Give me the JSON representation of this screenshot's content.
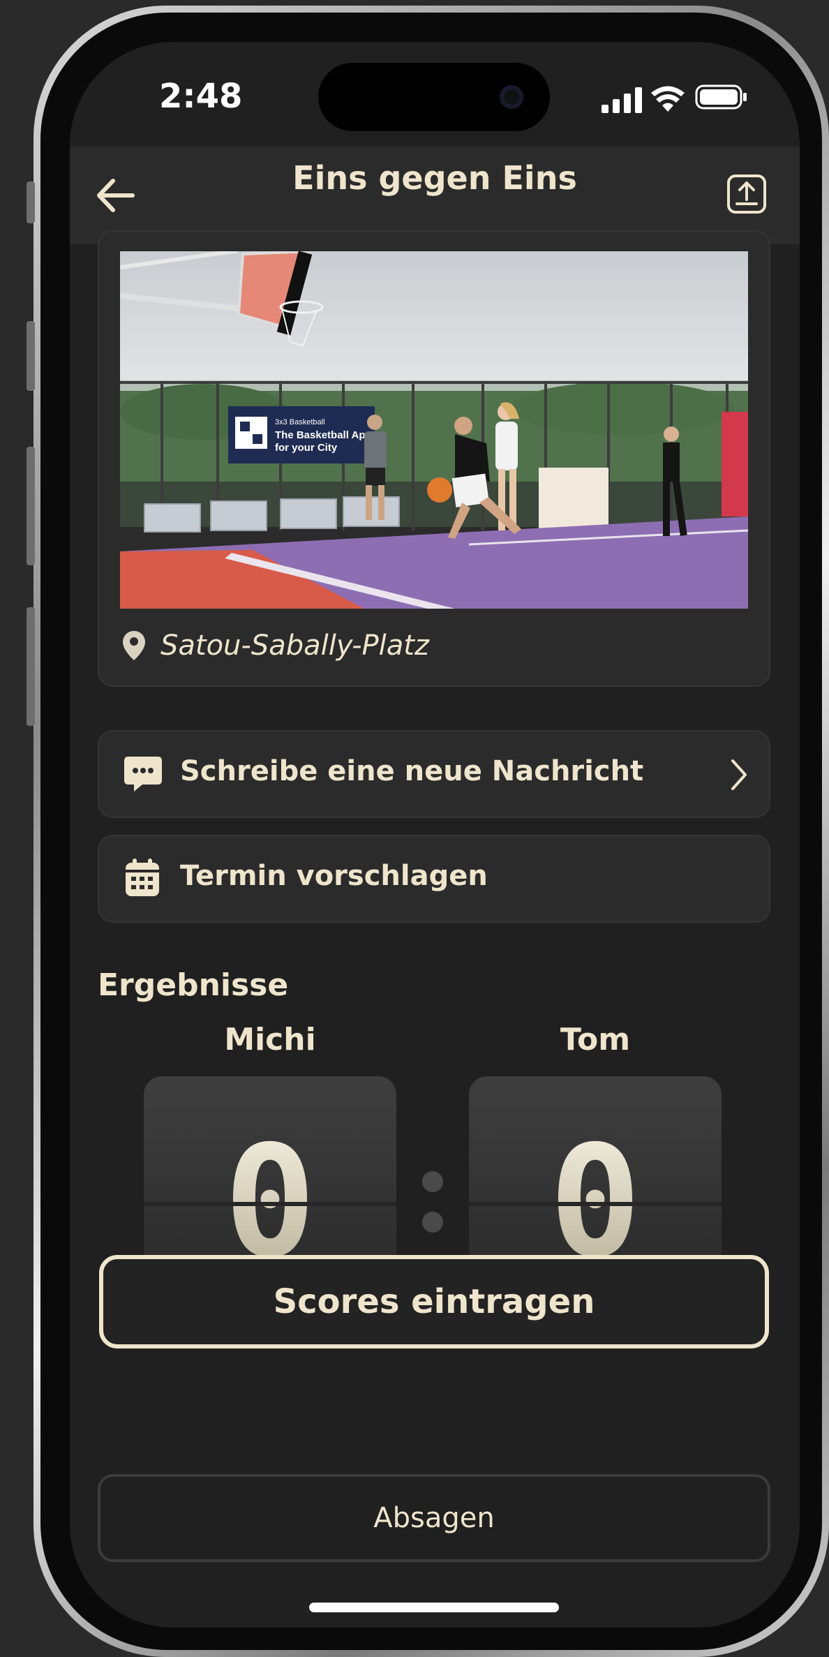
{
  "status_bar": {
    "time": "2:48"
  },
  "header": {
    "title": "Eins gegen Eins"
  },
  "location_card": {
    "photo_alt": "Basketball players on an outdoor court",
    "location_name": "Satou-Sabally-Platz",
    "banner_line1": "The Basketball App",
    "banner_line2": "for your City",
    "banner_brand": "3x3 Basketball"
  },
  "actions": {
    "message_label": "Schreibe eine neue Nachricht",
    "schedule_label": "Termin vorschlagen"
  },
  "results": {
    "section_title": "Ergebnisse",
    "player1_name": "Michi",
    "player2_name": "Tom",
    "player1_score": "0",
    "player2_score": "0",
    "enter_scores_label": "Scores eintragen"
  },
  "footer": {
    "cancel_label": "Absagen"
  },
  "colors": {
    "accent": "#efe5cd",
    "background": "#202020",
    "card": "#2b2b2b"
  }
}
